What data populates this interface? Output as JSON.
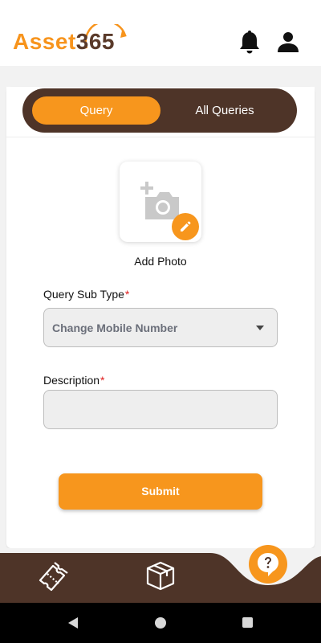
{
  "app": {
    "logo_asset": "Asset",
    "logo_number": "365"
  },
  "header": {
    "icons": [
      "bell-icon",
      "user-icon"
    ]
  },
  "tabs": [
    {
      "label": "Query",
      "active": true
    },
    {
      "label": "All Queries",
      "active": false
    }
  ],
  "photo": {
    "label": "Add Photo",
    "icon": "add-photo-icon",
    "badge_icon": "pencil-icon"
  },
  "form": {
    "sub_type_label": "Query Sub Type",
    "sub_type_required": "*",
    "sub_type_value": "Change Mobile Number",
    "description_label": "Description",
    "description_required": "*",
    "description_value": "",
    "submit_label": "Submit"
  },
  "bottom_nav": {
    "items": [
      "tickets-icon",
      "box-icon",
      "help-icon"
    ]
  },
  "colors": {
    "accent": "#f7961d",
    "brown": "#4e3428",
    "required": "#e02020"
  }
}
